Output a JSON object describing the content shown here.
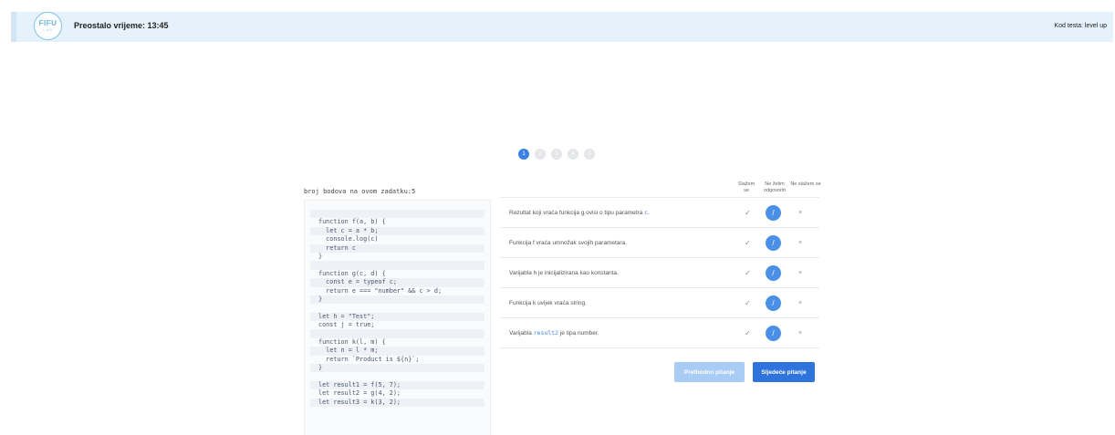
{
  "header": {
    "logo_line1": "FIFU",
    "logo_line2": "LAB",
    "timer": "Preostalo vrijeme: 13:45",
    "test_code": "Kod testa: level up"
  },
  "steps": [
    "1",
    "2",
    "3",
    "4",
    "5"
  ],
  "active_step": 1,
  "task": {
    "points_label": "broj bodova na ovom zadatku:5"
  },
  "code_lines": [
    "",
    "function f(a, b) {",
    "  let c = a * b;",
    "  console.log(c)",
    "  return c",
    "}",
    "",
    "function g(c, d) {",
    "  const e = typeof c;",
    "  return e === \"number\" && c > d;",
    "}",
    "",
    "let h = \"Test\";",
    "const j = true;",
    "",
    "function k(l, m) {",
    "  let n = l * m;",
    "  return `Product is ${n}`;",
    "}",
    "",
    "let result1 = f(5, 7);",
    "let result2 = g(4, 2);",
    "let result3 = k(3, 2);"
  ],
  "columns": {
    "agree": "Slažem se",
    "neutral": "Ne želim odgovoriti",
    "disagree": "Ne slažem se"
  },
  "statements": [
    {
      "before": "Rezultat koji vraća funkcija g ovisi o tipu parametra ",
      "code": "c",
      "after": "."
    },
    {
      "before": "Funkcija f vraća umnožak svojih parametara.",
      "code": "",
      "after": ""
    },
    {
      "before": "Varijabla h je inicijalizirana kao konstanta.",
      "code": "",
      "after": ""
    },
    {
      "before": "Funkcija k uvijek vraća string.",
      "code": "",
      "after": ""
    },
    {
      "before": "Varijabla ",
      "code": "result2",
      "after": " je tipa number."
    }
  ],
  "row_symbols": {
    "agree": "✓",
    "neutral": "/",
    "disagree": "×"
  },
  "buttons": {
    "prev": "Prethodno pitanje",
    "next": "Sljedeće pitanje"
  }
}
